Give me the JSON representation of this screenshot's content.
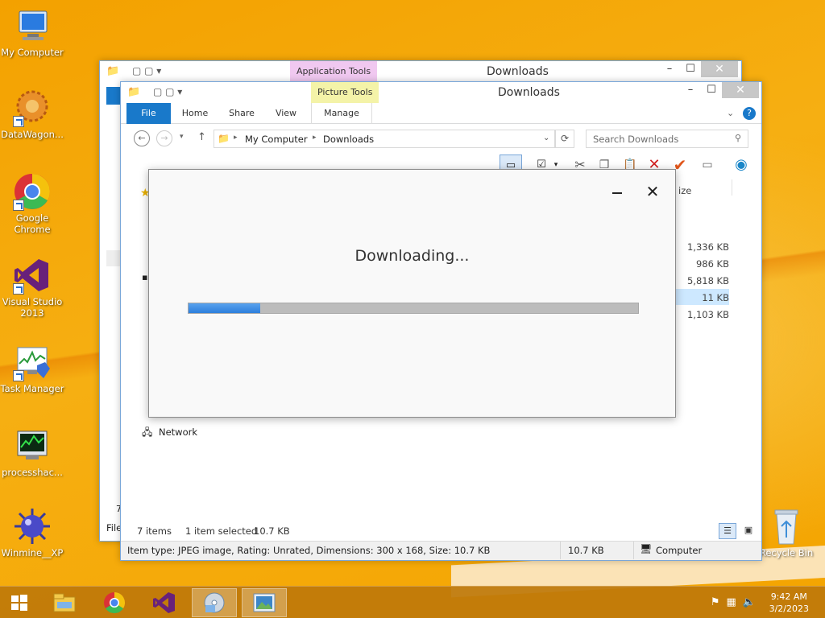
{
  "desktop": {
    "icons": [
      {
        "label": "My Computer"
      },
      {
        "label": "DataWagon..."
      },
      {
        "label": "Google Chrome"
      },
      {
        "label": "Visual Studio 2013"
      },
      {
        "label": "Task Manager"
      },
      {
        "label": "processhac..."
      },
      {
        "label": "Winmine__XP"
      },
      {
        "label": "Recycle Bin"
      }
    ]
  },
  "back_window": {
    "title": "Downloads",
    "context_tab": "Application Tools",
    "status_count": "7",
    "file_menu_partial": "File"
  },
  "front_window": {
    "title": "Downloads",
    "context_tab": "Picture Tools",
    "ribbon_tabs": [
      "File",
      "Home",
      "Share",
      "View",
      "Manage"
    ],
    "breadcrumb": [
      "My Computer",
      "Downloads"
    ],
    "search_placeholder": "Search Downloads",
    "column_header_partial": "ize",
    "sizes": [
      "1,336 KB",
      "986 KB",
      "5,818 KB",
      "11 KB",
      "1,103 KB"
    ],
    "nav_network": "Network",
    "status": {
      "items": "7 items",
      "selected": "1 item selected",
      "selected_size": "10.7 KB"
    },
    "details": {
      "info": "Item type: JPEG image, Rating: Unrated, Dimensions: 300 x 168, Size: 10.7 KB",
      "size": "10.7 KB",
      "location": "Computer"
    }
  },
  "dialog": {
    "title": "Downloading...",
    "progress": 0.16
  },
  "taskbar": {
    "time": "9:42 AM",
    "date": "3/2/2023"
  },
  "colors": {
    "accent": "#1979ca",
    "progress": "#3a8ae3",
    "desktop": "#f6a800",
    "app_tools_tab": "#f0c8f0",
    "picture_tools_tab": "#f4f3a8"
  }
}
